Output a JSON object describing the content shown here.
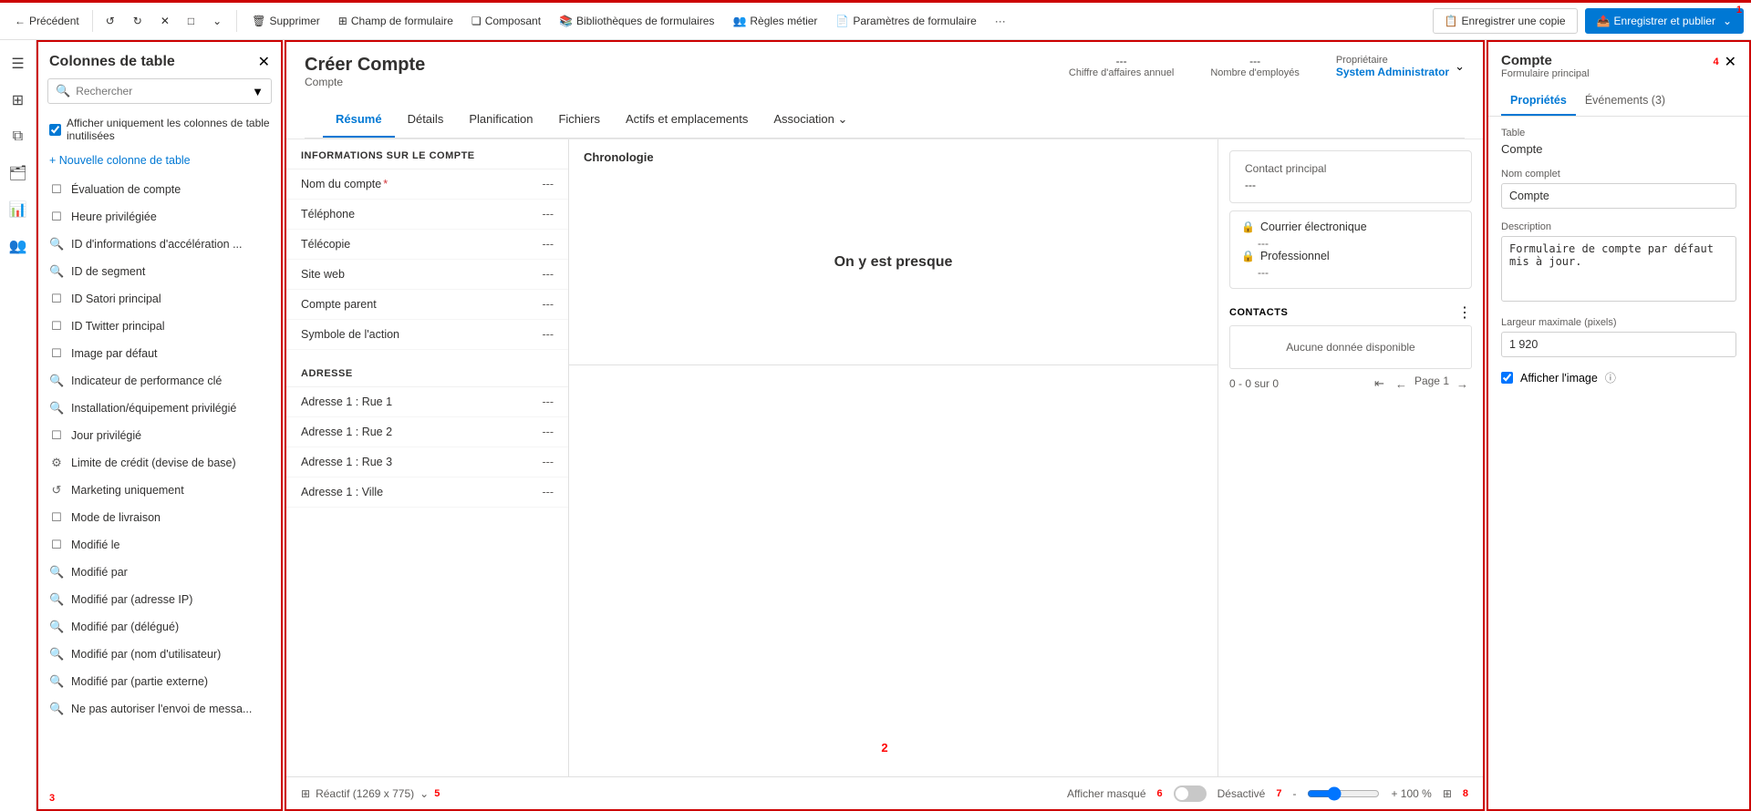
{
  "toolbar": {
    "back_label": "Précédent",
    "delete_label": "Supprimer",
    "form_field_label": "Champ de formulaire",
    "component_label": "Composant",
    "form_libraries_label": "Bibliothèques de formulaires",
    "business_rules_label": "Règles métier",
    "form_params_label": "Paramètres de formulaire",
    "more_label": "···",
    "save_copy_label": "Enregistrer une copie",
    "save_publish_label": "Enregistrer et publier",
    "num1": "1"
  },
  "left_panel": {
    "title": "Colonnes de table",
    "search_placeholder": "Rechercher",
    "checkbox_label": "Afficher uniquement les colonnes de table inutilisées",
    "new_col_label": "+ Nouvelle colonne de table",
    "num3": "3",
    "items": [
      {
        "icon": "☐",
        "label": "Évaluation de compte"
      },
      {
        "icon": "☐",
        "label": "Heure privilégiée"
      },
      {
        "icon": "🔍",
        "label": "ID d'informations d'accélération ..."
      },
      {
        "icon": "🔍",
        "label": "ID de segment"
      },
      {
        "icon": "☐",
        "label": "ID Satori principal"
      },
      {
        "icon": "☐",
        "label": "ID Twitter principal"
      },
      {
        "icon": "☐",
        "label": "Image par défaut"
      },
      {
        "icon": "🔍",
        "label": "Indicateur de performance clé"
      },
      {
        "icon": "🔍",
        "label": "Installation/équipement privilégié"
      },
      {
        "icon": "☐",
        "label": "Jour privilégié"
      },
      {
        "icon": "⚙",
        "label": "Limite de crédit (devise de base)"
      },
      {
        "icon": "↺",
        "label": "Marketing uniquement"
      },
      {
        "icon": "☐",
        "label": "Mode de livraison"
      },
      {
        "icon": "☐",
        "label": "Modifié le"
      },
      {
        "icon": "🔍",
        "label": "Modifié par"
      },
      {
        "icon": "🔍",
        "label": "Modifié par (adresse IP)"
      },
      {
        "icon": "🔍",
        "label": "Modifié par (délégué)"
      },
      {
        "icon": "🔍",
        "label": "Modifié par (nom d'utilisateur)"
      },
      {
        "icon": "🔍",
        "label": "Modifié par (partie externe)"
      },
      {
        "icon": "🔍",
        "label": "Ne pas autoriser l'envoi de messa..."
      }
    ]
  },
  "center": {
    "num2": "2",
    "form_title": "Créer Compte",
    "form_subtitle": "Compte",
    "meta": {
      "annual_label": "Chiffre d'affaires annuel",
      "annual_val": "---",
      "employees_label": "Nombre d'employés",
      "employees_val": "---",
      "owner_label": "Propriétaire",
      "owner_val": "System Administrator"
    },
    "tabs": [
      {
        "label": "Résumé",
        "active": true
      },
      {
        "label": "Détails"
      },
      {
        "label": "Planification"
      },
      {
        "label": "Fichiers"
      },
      {
        "label": "Actifs et emplacements"
      },
      {
        "label": "Association",
        "dropdown": true
      }
    ],
    "info_section": {
      "title": "INFORMATIONS SUR LE COMPTE",
      "fields": [
        {
          "label": "Nom du compte",
          "required": true,
          "val": "---"
        },
        {
          "label": "Téléphone",
          "val": "---"
        },
        {
          "label": "Télécopie",
          "val": "---"
        },
        {
          "label": "Site web",
          "val": "---"
        },
        {
          "label": "Compte parent",
          "val": "---"
        },
        {
          "label": "Symbole de l'action",
          "val": "---"
        }
      ]
    },
    "address_section": {
      "title": "ADRESSE",
      "fields": [
        {
          "label": "Adresse 1 : Rue 1",
          "val": "---"
        },
        {
          "label": "Adresse 1 : Rue 2",
          "val": "---"
        },
        {
          "label": "Adresse 1 : Rue 3",
          "val": "---"
        },
        {
          "label": "Adresse 1 : Ville",
          "val": "---"
        }
      ]
    },
    "chronologie": {
      "title": "Chronologie",
      "empty_msg": "On y est presque"
    },
    "contact_principal": {
      "label": "Contact principal",
      "val": "---"
    },
    "email_section": {
      "items": [
        {
          "type": "Courrier électronique",
          "val": "---"
        },
        {
          "type": "Professionnel",
          "val": "---"
        }
      ]
    },
    "contacts_section": {
      "title": "CONTACTS",
      "empty_msg": "Aucune donnée disponible",
      "pager": "0 - 0 sur 0",
      "page_label": "Page 1"
    }
  },
  "right_panel": {
    "num4": "4",
    "title": "Compte",
    "subtitle": "Formulaire principal",
    "tabs": [
      {
        "label": "Propriétés",
        "active": true
      },
      {
        "label": "Événements (3)"
      }
    ],
    "table_label": "Table",
    "table_val": "Compte",
    "full_name_label": "Nom complet",
    "full_name_val": "Compte",
    "description_label": "Description",
    "description_val": "Formulaire de compte par défaut mis à jour.",
    "max_width_label": "Largeur maximale (pixels)",
    "max_width_val": "1 920",
    "show_image_label": "Afficher l'image"
  },
  "status_bar": {
    "num5": "5",
    "num6": "6",
    "num7": "7",
    "num8": "8",
    "reactive_label": "Réactif (1269 x 775)",
    "show_hidden_label": "Afficher masqué",
    "toggle_label": "Désactivé",
    "zoom_label": "+ 100 %"
  }
}
